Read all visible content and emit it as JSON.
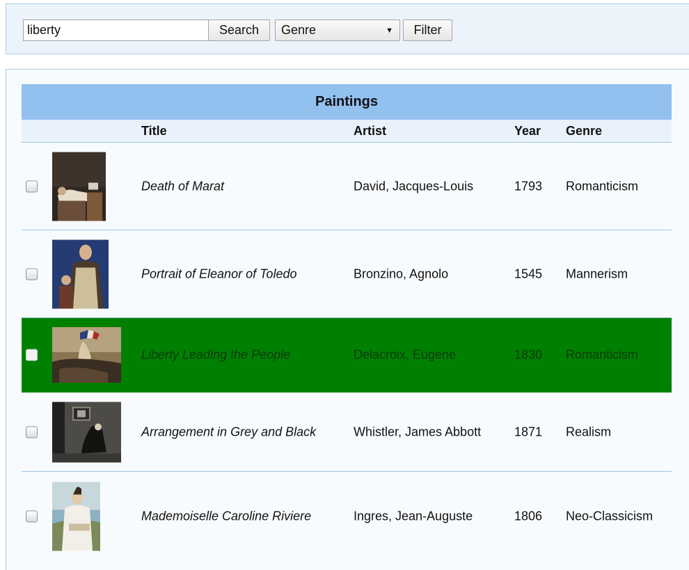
{
  "search": {
    "value": "liberty",
    "button_label": "Search"
  },
  "genre_select": {
    "selected": "Genre"
  },
  "filter": {
    "button_label": "Filter"
  },
  "table": {
    "caption": "Paintings",
    "columns": {
      "title": "Title",
      "artist": "Artist",
      "year": "Year",
      "genre": "Genre"
    },
    "rows": [
      {
        "title": "Death of Marat",
        "artist": "David, Jacques-Louis",
        "year": "1793",
        "genre": "Romanticism",
        "selected": false,
        "checked": false
      },
      {
        "title": "Portrait of Eleanor of Toledo",
        "artist": "Bronzino, Agnolo",
        "year": "1545",
        "genre": "Mannerism",
        "selected": false,
        "checked": false
      },
      {
        "title": "Liberty Leading the People",
        "artist": "Delacroix, Eugene",
        "year": "1830",
        "genre": "Romanticism",
        "selected": true,
        "checked": false
      },
      {
        "title": "Arrangement in Grey and Black",
        "artist": "Whistler, James Abbott",
        "year": "1871",
        "genre": "Realism",
        "selected": false,
        "checked": false
      },
      {
        "title": "Mademoiselle Caroline Riviere",
        "artist": "Ingres, Jean-Auguste",
        "year": "1806",
        "genre": "Neo-Classicism",
        "selected": false,
        "checked": false
      }
    ]
  },
  "colors": {
    "selected_row": "#008000",
    "caption_bg": "#92c0ef",
    "header_bg": "#e9f2fb"
  }
}
